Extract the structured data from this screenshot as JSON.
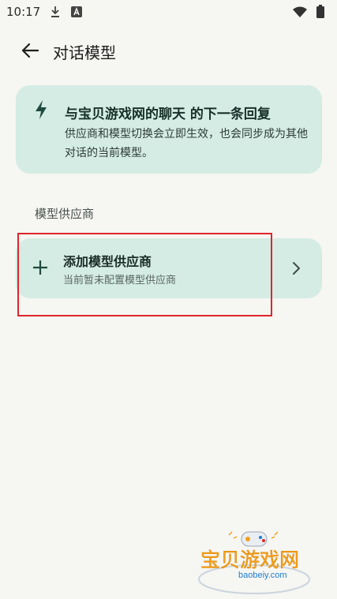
{
  "status_bar": {
    "time": "10:17",
    "icons": [
      "download-icon",
      "a-notification-icon",
      "wifi-icon",
      "battery-icon"
    ]
  },
  "top_bar": {
    "title": "对话模型",
    "back_icon": "arrow-left-icon"
  },
  "info_card": {
    "icon": "bolt-icon",
    "title": "与宝贝游戏网的聊天 的下一条回复",
    "description": "供应商和模型切换会立即生效，也会同步成为其他对话的当前模型。"
  },
  "providers": {
    "section_label": "模型供应商",
    "add_item": {
      "icon": "plus-icon",
      "title": "添加模型供应商",
      "subtitle": "当前暂未配置模型供应商",
      "trailing_icon": "chevron-right-icon"
    }
  },
  "watermark": {
    "text": "宝贝游戏网",
    "url": "baobeiy.com"
  },
  "colors": {
    "background": "#f6f6f2",
    "card": "#d4ece4",
    "accent": "#1e4a3f",
    "highlight": "#e0252b",
    "watermark_text": "#f3a01b",
    "watermark_url": "#1e7dcf"
  }
}
